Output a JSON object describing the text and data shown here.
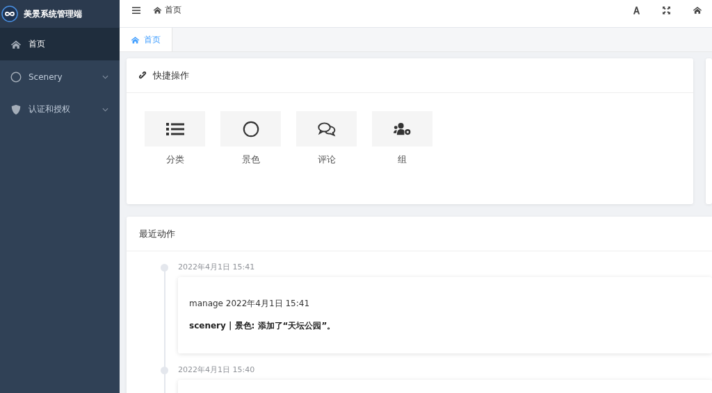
{
  "sidebar": {
    "logo_text": "美景系统管理端",
    "items": [
      {
        "label": "首页",
        "kind": "home",
        "selected": true,
        "has_children": false
      },
      {
        "label": "Scenery",
        "kind": "circle",
        "selected": false,
        "has_children": true
      },
      {
        "label": "认证和授权",
        "kind": "shield",
        "selected": false,
        "has_children": true
      }
    ]
  },
  "topbar": {
    "breadcrumb": "首页"
  },
  "tabs": [
    {
      "label": "首页",
      "selected": true
    }
  ],
  "quick_actions": {
    "title": "快捷操作",
    "items": [
      {
        "label": "分类",
        "kind": "list"
      },
      {
        "label": "景色",
        "kind": "circle"
      },
      {
        "label": "评论",
        "kind": "comments"
      },
      {
        "label": "组",
        "kind": "users-gear"
      }
    ]
  },
  "recent_actions": {
    "title": "最近动作",
    "entries": [
      {
        "time": "2022年4月1日 15:41",
        "user_line": "manage 2022年4月1日 15:41",
        "message": "scenery | 景色: 添加了“天坛公园”。"
      },
      {
        "time": "2022年4月1日 15:40"
      }
    ]
  }
}
